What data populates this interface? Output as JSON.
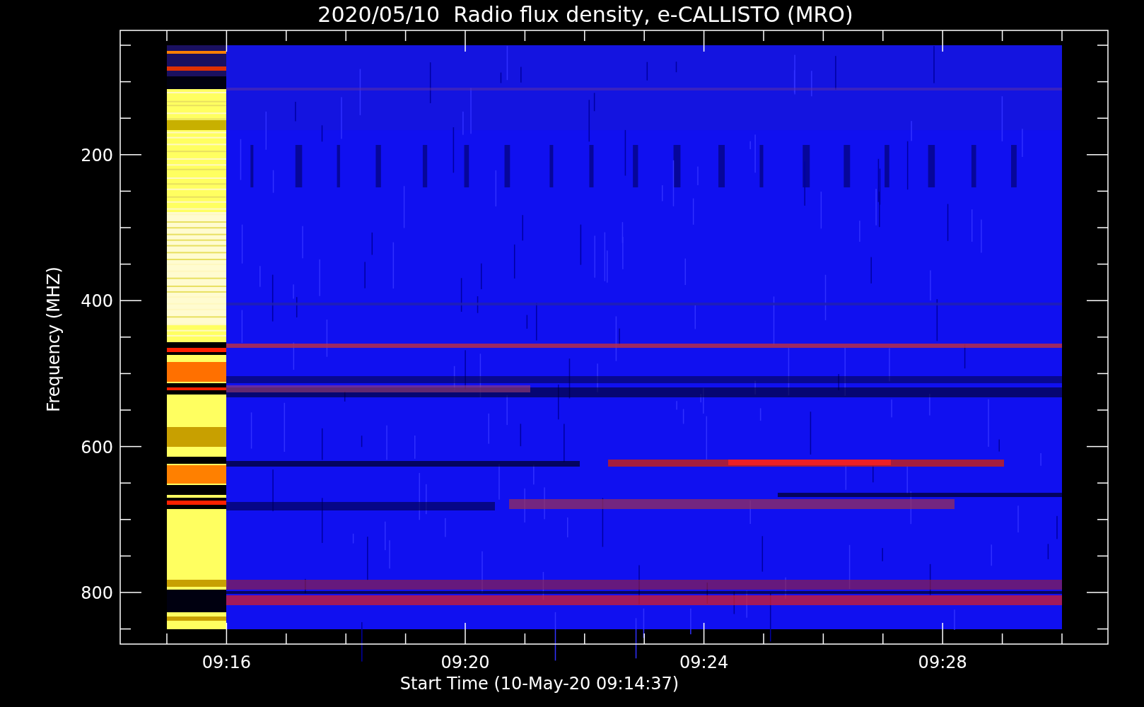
{
  "title": "2020/05/10  Radio flux density, e-CALLISTO (MRO)",
  "y_axis": {
    "label": "Frequency (MHZ)",
    "ticks": [
      "200",
      "400",
      "600",
      "800"
    ]
  },
  "x_axis": {
    "label": "Start Time (10-May-20 09:14:37)",
    "ticks": [
      "09:16",
      "09:20",
      "09:24",
      "09:28"
    ]
  }
}
